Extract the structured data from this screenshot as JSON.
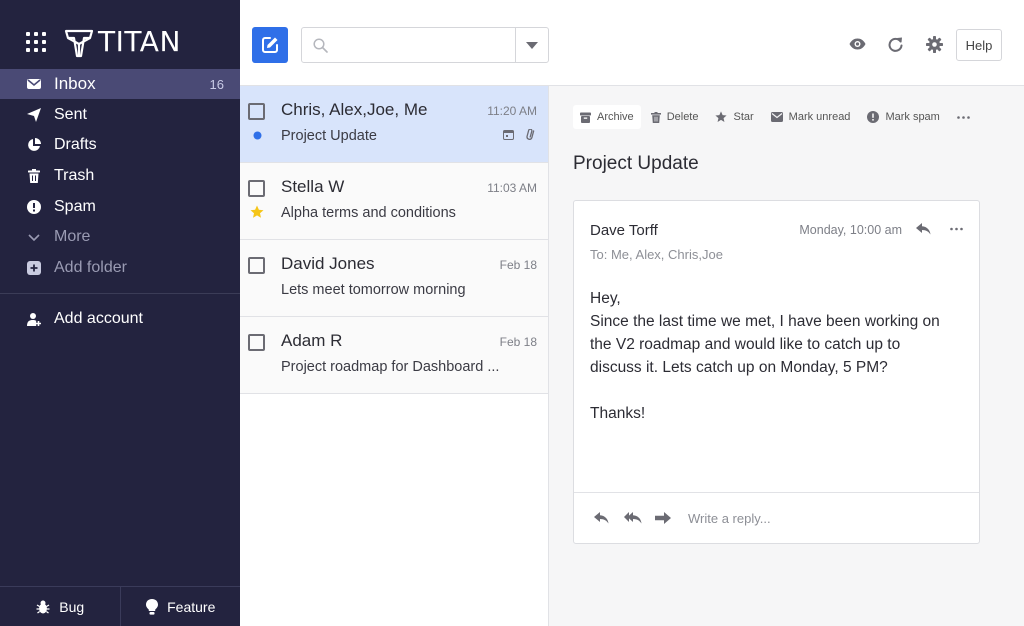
{
  "app": {
    "name": "TITAN"
  },
  "sidebar": {
    "items": [
      {
        "label": "Inbox",
        "count": "16"
      },
      {
        "label": "Sent"
      },
      {
        "label": "Drafts"
      },
      {
        "label": "Trash"
      },
      {
        "label": "Spam"
      },
      {
        "label": "More"
      },
      {
        "label": "Add folder"
      }
    ],
    "account": {
      "label": "Add account"
    },
    "bottom": {
      "bug": "Bug",
      "feature": "Feature"
    }
  },
  "toolbar": {
    "search_placeholder": "",
    "help_label": "Help"
  },
  "messages": [
    {
      "from": "Chris, Alex,Joe, Me",
      "date": "11:20 AM",
      "subject": "Project Update",
      "selected": true,
      "marker": "unread-dot",
      "has_calendar": true,
      "has_attachment": true
    },
    {
      "from": "Stella W",
      "date": "11:03 AM",
      "subject": "Alpha terms and conditions",
      "marker": "star"
    },
    {
      "from": "David Jones",
      "date": "Feb 18",
      "subject": "Lets meet tomorrow morning"
    },
    {
      "from": "Adam R",
      "date": "Feb 18",
      "subject": "Project roadmap for Dashboard ..."
    }
  ],
  "reader": {
    "actions": {
      "archive": "Archive",
      "delete": "Delete",
      "star": "Star",
      "mark_unread": "Mark unread",
      "mark_spam": "Mark spam"
    },
    "subject": "Project Update",
    "email": {
      "sender": "Dave Torff",
      "time": "Monday, 10:00 am",
      "to": "To: Me, Alex, Chris,Joe",
      "body_lines": [
        "Hey,",
        "Since the last time we met, I have been working on",
        "the V2 roadmap and would like to catch up to",
        "discuss it.  Lets catch up on Monday, 5 PM?",
        "",
        "Thanks!"
      ],
      "reply_placeholder": "Write a reply..."
    }
  },
  "colors": {
    "sidebar_bg": "#23233f",
    "sidebar_active": "#4a4a75",
    "accent": "#2f6fe8",
    "selected_row": "#d8e4fb",
    "star": "#f5c518"
  }
}
